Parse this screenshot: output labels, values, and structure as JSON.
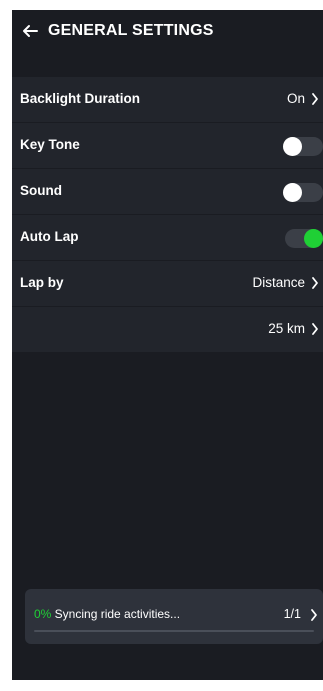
{
  "header": {
    "title": "GENERAL SETTINGS",
    "back_icon": "arrow-left-icon"
  },
  "settings": [
    {
      "label": "Backlight Duration",
      "type": "link",
      "value": "On"
    },
    {
      "label": "Key Tone",
      "type": "toggle",
      "on": false
    },
    {
      "label": "Sound",
      "type": "toggle",
      "on": false
    },
    {
      "label": "Auto Lap",
      "type": "toggle",
      "on": true
    },
    {
      "label": "Lap by",
      "type": "link",
      "value": "Distance"
    },
    {
      "label": "",
      "type": "link",
      "value": "25 km"
    }
  ],
  "sync": {
    "percent_label": "0%",
    "status": " Syncing ride activities...",
    "count": "1/1",
    "progress": 0
  },
  "colors": {
    "background": "#1a1c22",
    "row": "#22252c",
    "accent": "#1fd035",
    "toggle_track": "#3b3f47",
    "card": "#2e323b"
  }
}
